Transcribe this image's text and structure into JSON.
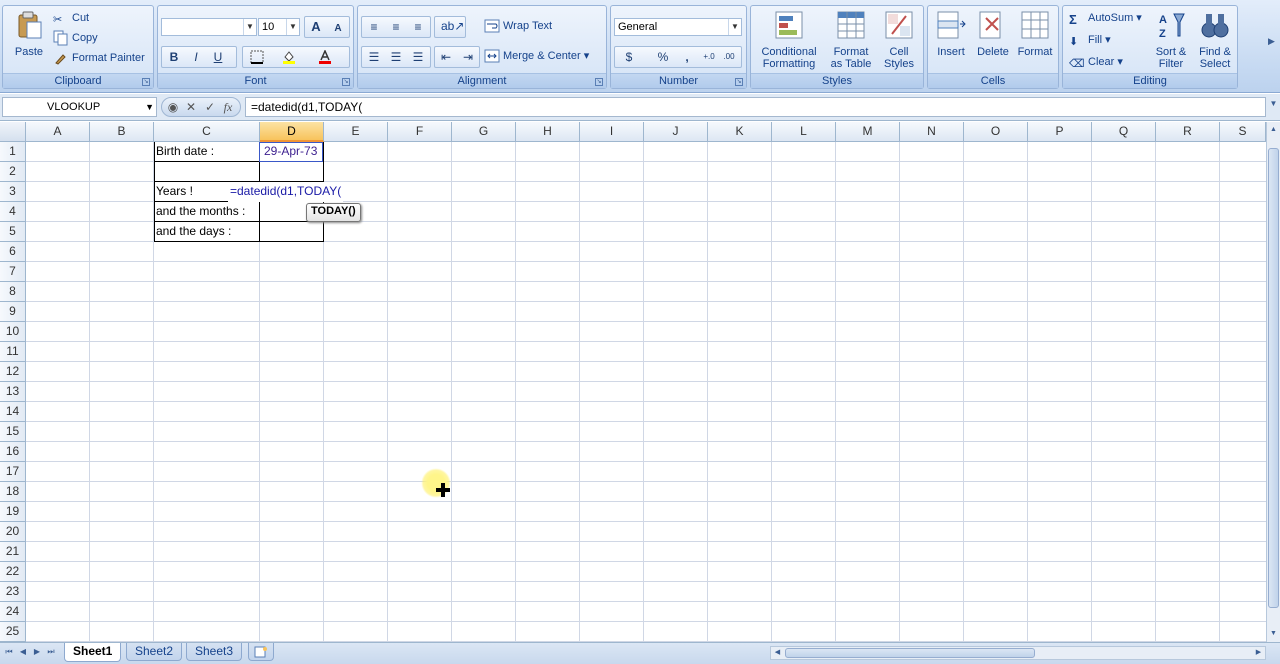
{
  "ribbon": {
    "clipboard": {
      "label": "Clipboard",
      "paste": "Paste",
      "cut": "Cut",
      "copy": "Copy",
      "format_painter": "Format Painter"
    },
    "font": {
      "label": "Font",
      "font_name": "",
      "font_size": "10",
      "bold": "B",
      "italic": "I",
      "underline": "U",
      "grow": "A",
      "shrink": "A"
    },
    "alignment": {
      "label": "Alignment",
      "wrap_text": "Wrap Text",
      "merge_center": "Merge & Center"
    },
    "number": {
      "label": "Number",
      "format": "General",
      "currency": "$",
      "percent": "%",
      "comma": ",",
      "inc_decimal": "+.0",
      "dec_decimal": ".00"
    },
    "styles": {
      "label": "Styles",
      "conditional_1": "Conditional",
      "conditional_2": "Formatting",
      "format_table_1": "Format",
      "format_table_2": "as Table",
      "cell_styles_1": "Cell",
      "cell_styles_2": "Styles"
    },
    "cells": {
      "label": "Cells",
      "insert": "Insert",
      "delete": "Delete",
      "format": "Format"
    },
    "editing": {
      "label": "Editing",
      "autosum": "AutoSum",
      "fill": "Fill",
      "clear": "Clear",
      "sort_1": "Sort &",
      "sort_2": "Filter",
      "find_1": "Find &",
      "find_2": "Select"
    }
  },
  "formula_bar": {
    "name_box": "VLOOKUP",
    "formula": "=datedid(d1,TODAY("
  },
  "columns": [
    "A",
    "B",
    "C",
    "D",
    "E",
    "F",
    "G",
    "H",
    "I",
    "J",
    "K",
    "L",
    "M",
    "N",
    "O",
    "P",
    "Q",
    "R",
    "S"
  ],
  "rows": [
    "1",
    "2",
    "3",
    "4",
    "5",
    "6",
    "7",
    "8",
    "9",
    "10",
    "11",
    "12",
    "13",
    "14",
    "15",
    "16",
    "17",
    "18",
    "19",
    "20",
    "21",
    "22",
    "23",
    "24",
    "25"
  ],
  "cells": {
    "c1": "Birth date :",
    "d1": "29-Apr-73",
    "c3": "Years !",
    "d3": "=datedid(d1,TODAY(",
    "c4": "and the months :",
    "c5": "and the days :"
  },
  "tooltip": "TODAY()",
  "sheets": [
    "Sheet1",
    "Sheet2",
    "Sheet3"
  ],
  "colors": {
    "accent": "#15428b",
    "selected_header": "#f8c35c",
    "ribbon": "#c7daf2",
    "d1_text": "#3c1f8f",
    "formula_text": "#1a1aa6"
  }
}
